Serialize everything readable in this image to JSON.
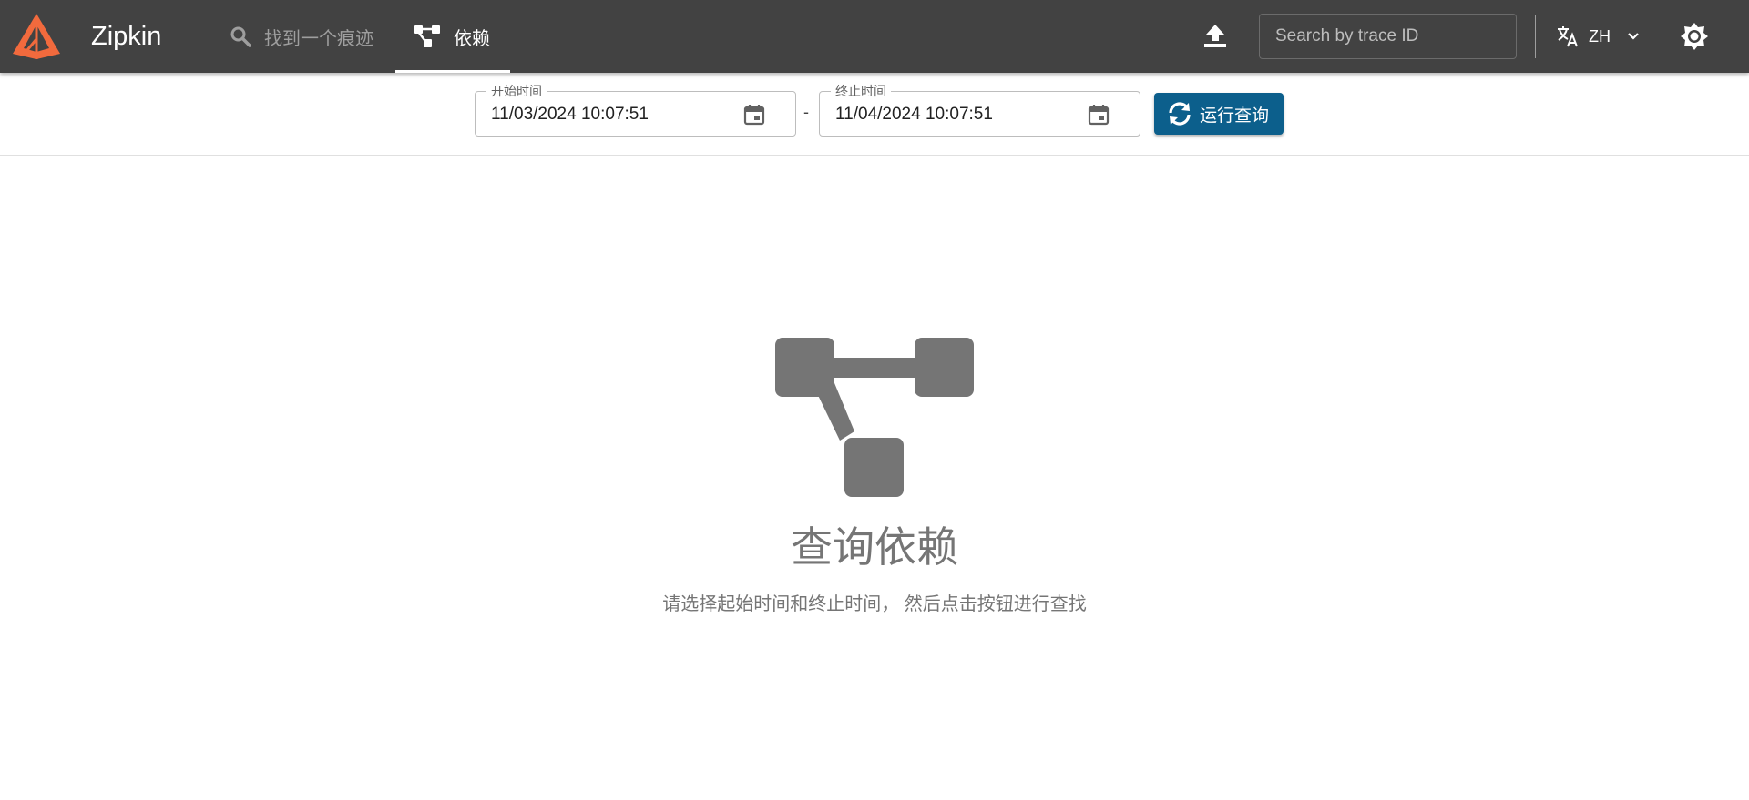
{
  "app": {
    "brand": "Zipkin"
  },
  "nav": {
    "find_trace": "找到一个痕迹",
    "dependencies": "依赖"
  },
  "header": {
    "trace_search_placeholder": "Search by trace ID",
    "language": "ZH"
  },
  "toolbar": {
    "start_label": "开始时间",
    "start_value": "11/03/2024 10:07:51",
    "separator": "-",
    "end_label": "终止时间",
    "end_value": "11/04/2024 10:07:51",
    "run_query": "运行查询"
  },
  "empty_state": {
    "title": "查询依赖",
    "description": "请选择起始时间和终止时间， 然后点击按钮进行查找"
  },
  "colors": {
    "header_bg": "#424242",
    "logo_orange": "#f26a3d",
    "primary_button": "#0c5f8c",
    "empty_icon": "#757575"
  },
  "icons": {
    "search": "search-icon",
    "dependencies": "dependency-graph-icon",
    "upload": "upload-icon",
    "language": "translate-icon",
    "dropdown": "chevron-down-icon",
    "theme": "brightness-icon",
    "calendar": "calendar-icon",
    "refresh": "sync-icon"
  }
}
